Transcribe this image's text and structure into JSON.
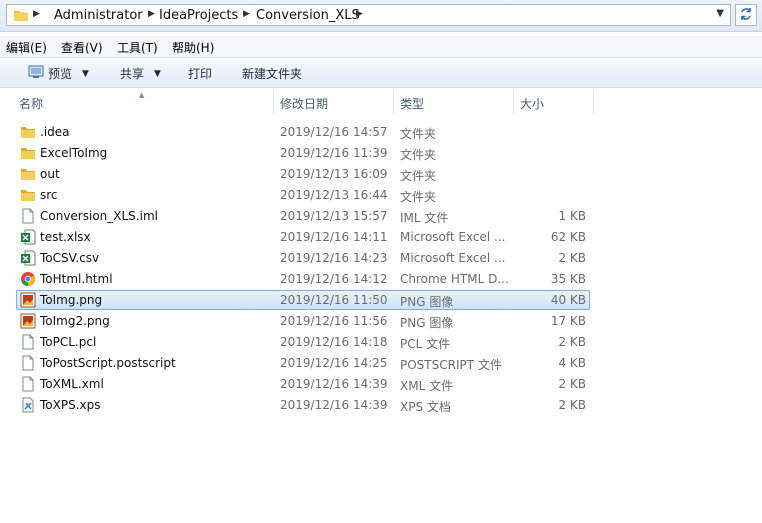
{
  "address": {
    "breadcrumbs": [
      "Administrator",
      "IdeaProjects",
      "Conversion_XLS"
    ]
  },
  "menu": [
    "编辑(E)",
    "查看(V)",
    "工具(T)",
    "帮助(H)"
  ],
  "toolbar": {
    "preview": "预览",
    "share": "共享",
    "print": "打印",
    "new_folder": "新建文件夹"
  },
  "columns": {
    "name": "名称",
    "modified": "修改日期",
    "type": "类型",
    "size": "大小"
  },
  "files": [
    {
      "name": ".idea",
      "date": "2019/12/16 14:57",
      "type": "文件夹",
      "size": "",
      "icon": "folder-icon"
    },
    {
      "name": "ExcelToImg",
      "date": "2019/12/16 11:39",
      "type": "文件夹",
      "size": "",
      "icon": "folder-icon"
    },
    {
      "name": "out",
      "date": "2019/12/13 16:09",
      "type": "文件夹",
      "size": "",
      "icon": "folder-icon"
    },
    {
      "name": "src",
      "date": "2019/12/13 16:44",
      "type": "文件夹",
      "size": "",
      "icon": "folder-icon"
    },
    {
      "name": "Conversion_XLS.iml",
      "date": "2019/12/13 15:57",
      "type": "IML 文件",
      "size": "1 KB",
      "icon": "document-icon"
    },
    {
      "name": "test.xlsx",
      "date": "2019/12/16 14:11",
      "type": "Microsoft Excel ...",
      "size": "62 KB",
      "icon": "excel-icon"
    },
    {
      "name": "ToCSV.csv",
      "date": "2019/12/16 14:23",
      "type": "Microsoft Excel ...",
      "size": "2 KB",
      "icon": "excel-icon"
    },
    {
      "name": "ToHtml.html",
      "date": "2019/12/16 14:12",
      "type": "Chrome HTML D...",
      "size": "35 KB",
      "icon": "chrome-icon"
    },
    {
      "name": "ToImg.png",
      "date": "2019/12/16 11:50",
      "type": "PNG 图像",
      "size": "40 KB",
      "icon": "image-icon",
      "selected": true
    },
    {
      "name": "ToImg2.png",
      "date": "2019/12/16 11:56",
      "type": "PNG 图像",
      "size": "17 KB",
      "icon": "image-icon"
    },
    {
      "name": "ToPCL.pcl",
      "date": "2019/12/16 14:18",
      "type": "PCL 文件",
      "size": "2 KB",
      "icon": "document-icon"
    },
    {
      "name": "ToPostScript.postscript",
      "date": "2019/12/16 14:25",
      "type": "POSTSCRIPT 文件",
      "size": "4 KB",
      "icon": "document-icon"
    },
    {
      "name": "ToXML.xml",
      "date": "2019/12/16 14:39",
      "type": "XML 文件",
      "size": "2 KB",
      "icon": "document-icon"
    },
    {
      "name": "ToXPS.xps",
      "date": "2019/12/16 14:39",
      "type": "XPS 文档",
      "size": "2 KB",
      "icon": "xps-icon"
    }
  ]
}
